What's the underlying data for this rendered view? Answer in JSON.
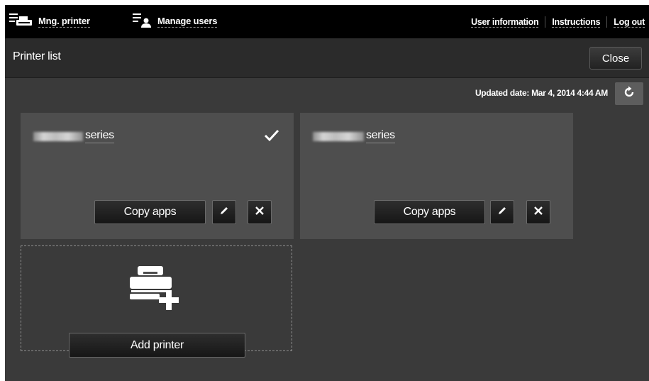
{
  "nav": {
    "mng_printer": "Mng. printer",
    "manage_users": "Manage users",
    "user_information": "User information",
    "instructions": "Instructions",
    "log_out": "Log out"
  },
  "header": {
    "title": "Printer list",
    "close_label": "Close"
  },
  "updated": {
    "text": "Updated date: Mar 4, 2014 4:44 AM"
  },
  "printers": [
    {
      "name": "series",
      "selected": true,
      "copy_label": "Copy apps"
    },
    {
      "name": "series",
      "selected": false,
      "copy_label": "Copy apps"
    }
  ],
  "add_printer": {
    "label": "Add printer"
  },
  "icons": {
    "mng_printer": "printer-list-icon",
    "manage_users": "user-list-icon",
    "refresh": "refresh-icon",
    "selected": "checkmark-icon",
    "edit": "pencil-icon",
    "delete": "close-x-icon",
    "add_printer": "add-printer-icon"
  },
  "colors": {
    "topbar": "#000000",
    "background": "#3a3a3a",
    "card": "#4e4e4e",
    "button": "#1c1c1c",
    "refresh_button": "#5d5d5d"
  }
}
